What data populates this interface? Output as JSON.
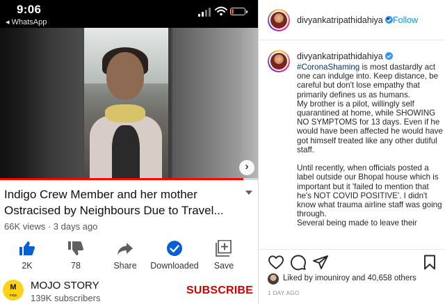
{
  "status_bar": {
    "time": "9:06",
    "back_app": "◂ WhatsApp"
  },
  "video": {
    "title_line1": "Indigo Crew Member and her mother",
    "title_line2": "Ostracised by Neighbours Due to Travel...",
    "meta": "66K views · 3 days ago",
    "progress_fraction": 0.94
  },
  "actions": {
    "like": "2K",
    "dislike": "78",
    "share": "Share",
    "downloaded": "Downloaded",
    "save": "Save"
  },
  "channel": {
    "logo_text": "M",
    "logo_subtext": "mojo",
    "name": "MOJO STORY",
    "subscribers": "139K subscribers",
    "subscribe": "SUBSCRIBE"
  },
  "instagram": {
    "username": "divyankatripathidahiya",
    "dot": "•",
    "follow": "Follow",
    "caption_username": "divyankatripathidahiya",
    "caption": {
      "hashtag": "#CoronaShaming",
      "para1_rest": " is most dastardly act one can indulge into. Keep distance, be careful but don't lose empathy that primarily defines us as humans.",
      "para2": "My brother is a pilot, willingly self quarantined at home, while SHOWING NO SYMPTOMS for 13 days. Even if he would have been affected he would have got himself treated like any other dutiful staff.",
      "para3": "Until recently, when officials posted a label outside our Bhopal house which is important but it 'failed to mention that he's NOT COVID POSITIVE'. I didn't know what trauma airline staff was going through.",
      "para4": "Several being made to leave their"
    },
    "likes": "Liked by imouniroy and 40,658 others",
    "time": "1 DAY AGO"
  },
  "colors": {
    "youtube_red": "#ff0000",
    "subscribe_red": "#cc0000",
    "youtube_blue": "#065fd4",
    "instagram_blue": "#0095f6",
    "hashtag_blue": "#00376b",
    "mojo_yellow": "#ffd21a"
  }
}
